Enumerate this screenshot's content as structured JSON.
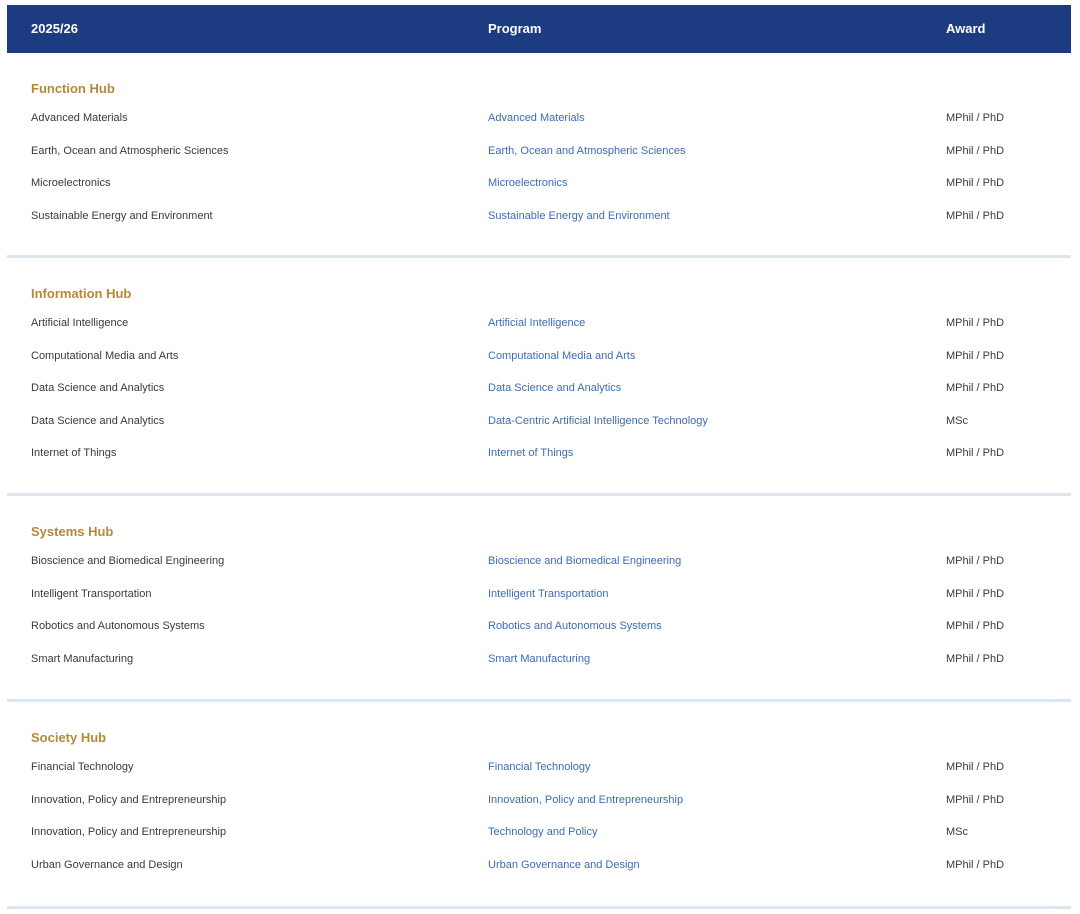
{
  "header": {
    "col_year": "2025/26",
    "col_program": "Program",
    "col_award": "Award"
  },
  "hubs": [
    {
      "title": "Function Hub",
      "rows": [
        {
          "area": "Advanced Materials",
          "program": "Advanced Materials",
          "award": "MPhil / PhD"
        },
        {
          "area": "Earth, Ocean and Atmospheric Sciences",
          "program": "Earth, Ocean and Atmospheric Sciences",
          "award": "MPhil / PhD"
        },
        {
          "area": "Microelectronics",
          "program": "Microelectronics",
          "award": "MPhil / PhD"
        },
        {
          "area": "Sustainable Energy and Environment",
          "program": "Sustainable Energy and Environment",
          "award": "MPhil / PhD"
        }
      ]
    },
    {
      "title": "Information Hub",
      "rows": [
        {
          "area": "Artificial Intelligence",
          "program": "Artificial Intelligence",
          "award": "MPhil / PhD"
        },
        {
          "area": "Computational Media and Arts",
          "program": "Computational Media and Arts",
          "award": "MPhil / PhD"
        },
        {
          "area": "Data Science and Analytics",
          "program": "Data Science and Analytics",
          "award": "MPhil / PhD"
        },
        {
          "area": "Data Science and Analytics",
          "program": "Data-Centric Artificial Intelligence Technology",
          "award": "MSc"
        },
        {
          "area": "Internet of Things",
          "program": "Internet of Things",
          "award": "MPhil / PhD"
        }
      ]
    },
    {
      "title": "Systems Hub",
      "rows": [
        {
          "area": "Bioscience and Biomedical Engineering",
          "program": "Bioscience and Biomedical Engineering",
          "award": "MPhil / PhD"
        },
        {
          "area": "Intelligent Transportation",
          "program": "Intelligent Transportation",
          "award": "MPhil / PhD"
        },
        {
          "area": "Robotics and Autonomous Systems",
          "program": "Robotics and Autonomous Systems",
          "award": "MPhil / PhD"
        },
        {
          "area": "Smart Manufacturing",
          "program": "Smart Manufacturing",
          "award": "MPhil / PhD"
        }
      ]
    },
    {
      "title": "Society Hub",
      "rows": [
        {
          "area": "Financial Technology",
          "program": "Financial Technology",
          "award": "MPhil / PhD"
        },
        {
          "area": "Innovation, Policy and Entrepreneurship",
          "program": "Innovation, Policy and Entrepreneurship",
          "award": "MPhil / PhD"
        },
        {
          "area": "Innovation, Policy and Entrepreneurship",
          "program": "Technology and Policy",
          "award": "MSc"
        },
        {
          "area": "Urban Governance and Design",
          "program": "Urban Governance and Design",
          "award": "MPhil / PhD"
        }
      ]
    }
  ],
  "colors": {
    "header_bg": "#1c3b80",
    "hub_title": "#b5893a",
    "program_link": "#3d6cb3",
    "divider": "#dbe6f1"
  }
}
